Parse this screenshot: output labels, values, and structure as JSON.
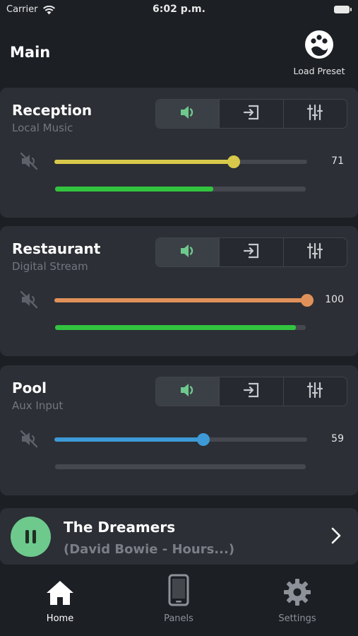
{
  "status_bar": {
    "carrier": "Carrier",
    "time": "6:02 p.m."
  },
  "header": {
    "title": "Main",
    "preset_label": "Load Preset"
  },
  "zones": [
    {
      "name": "Reception",
      "source": "Local Music",
      "volume": 71,
      "volume_display": "71",
      "volume_color": "#d9c94a",
      "meter_level": 0.63
    },
    {
      "name": "Restaurant",
      "source": "Digital Stream",
      "volume": 100,
      "volume_display": "100",
      "volume_color": "#e0915a",
      "meter_level": 0.96
    },
    {
      "name": "Pool",
      "source": "Aux Input",
      "volume": 59,
      "volume_display": "59",
      "volume_color": "#3d9ad6",
      "meter_level": 0.0
    }
  ],
  "now_playing": {
    "title": "The Dreamers",
    "subtitle": "(David Bowie - Hours...)"
  },
  "tabs": [
    {
      "label": "Home",
      "active": true
    },
    {
      "label": "Panels",
      "active": false
    },
    {
      "label": "Settings",
      "active": false
    }
  ],
  "colors": {
    "accent_green": "#6ec98d",
    "meter_green": "#33c43f",
    "card_bg": "#2c2f35",
    "page_bg": "#1c1f24"
  }
}
